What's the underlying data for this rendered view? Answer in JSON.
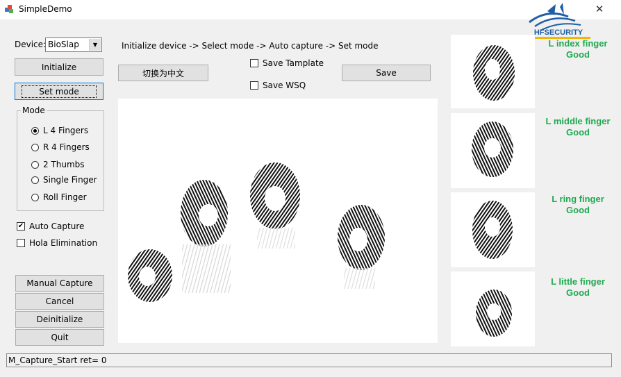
{
  "window": {
    "title": "SimpleDemo",
    "logo_text": "HFSECURITY",
    "close_glyph": "✕"
  },
  "device": {
    "label": "Device:",
    "selected": "BioSlap"
  },
  "buttons": {
    "initialize": "Initialize",
    "set_mode": "Set mode",
    "switch_chinese": "切换为中文",
    "save": "Save",
    "manual_capture": "Manual Capture",
    "cancel": "Cancel",
    "deinitialize": "Deinitialize",
    "quit": "Quit"
  },
  "instructions": "Initialize device -> Select mode -> Auto capture -> Set mode",
  "save_options": {
    "save_template": "Save Tamplate",
    "save_wsq": "Save WSQ"
  },
  "mode": {
    "legend": "Mode",
    "options": [
      "L 4 Fingers",
      "R 4 Fingers",
      "2 Thumbs",
      "Single Finger",
      "Roll Finger"
    ],
    "selected_index": 0
  },
  "options": {
    "auto_capture": "Auto Capture",
    "hola_elimination": "Hola Elimination"
  },
  "fingers": [
    {
      "name": "L index finger",
      "quality": "Good"
    },
    {
      "name": "L middle finger",
      "quality": "Good"
    },
    {
      "name": "L ring finger",
      "quality": "Good"
    },
    {
      "name": "L little finger",
      "quality": "Good"
    }
  ],
  "status_text": "M_Capture_Start  ret= 0",
  "colors": {
    "quality_label": "#1faa4f",
    "focus_border": "#0078d7",
    "logo_blue": "#1e5fa8",
    "logo_gold": "#f2b705"
  }
}
